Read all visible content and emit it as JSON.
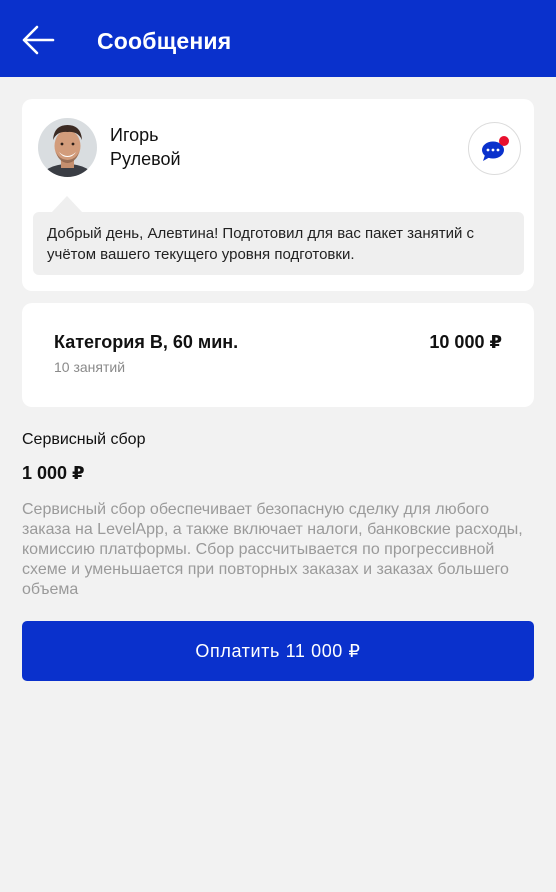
{
  "header": {
    "title": "Сообщения",
    "back_icon": "arrow-left-icon"
  },
  "message": {
    "author_first_name": "Игорь",
    "author_last_name": "Рулевой",
    "text": "Добрый день, Алевтина! Подготовил для вас пакет занятий с учётом вашего текущего уровня подготовки.",
    "chat_icon": "chat-bubble-icon",
    "notification_color": "#e8102e"
  },
  "package": {
    "title": "Категория B, 60 мин.",
    "subtitle": "10 занятий",
    "price": "10 000 ₽"
  },
  "service_fee": {
    "label": "Сервисный сбор",
    "value": "1 000 ₽",
    "description": "Сервисный сбор обеспечивает безопасную сделку для любого заказа на LevelApp, а также включает налоги, банковские расходы, комиссию платформы. Сбор рассчитывается по прогрессивной схеме и уменьшается при повторных заказах и заказах большего объема"
  },
  "pay_button": {
    "label": "Оплатить 11 000 ₽"
  },
  "colors": {
    "accent": "#0a31cc",
    "background": "#f2f2f2"
  }
}
